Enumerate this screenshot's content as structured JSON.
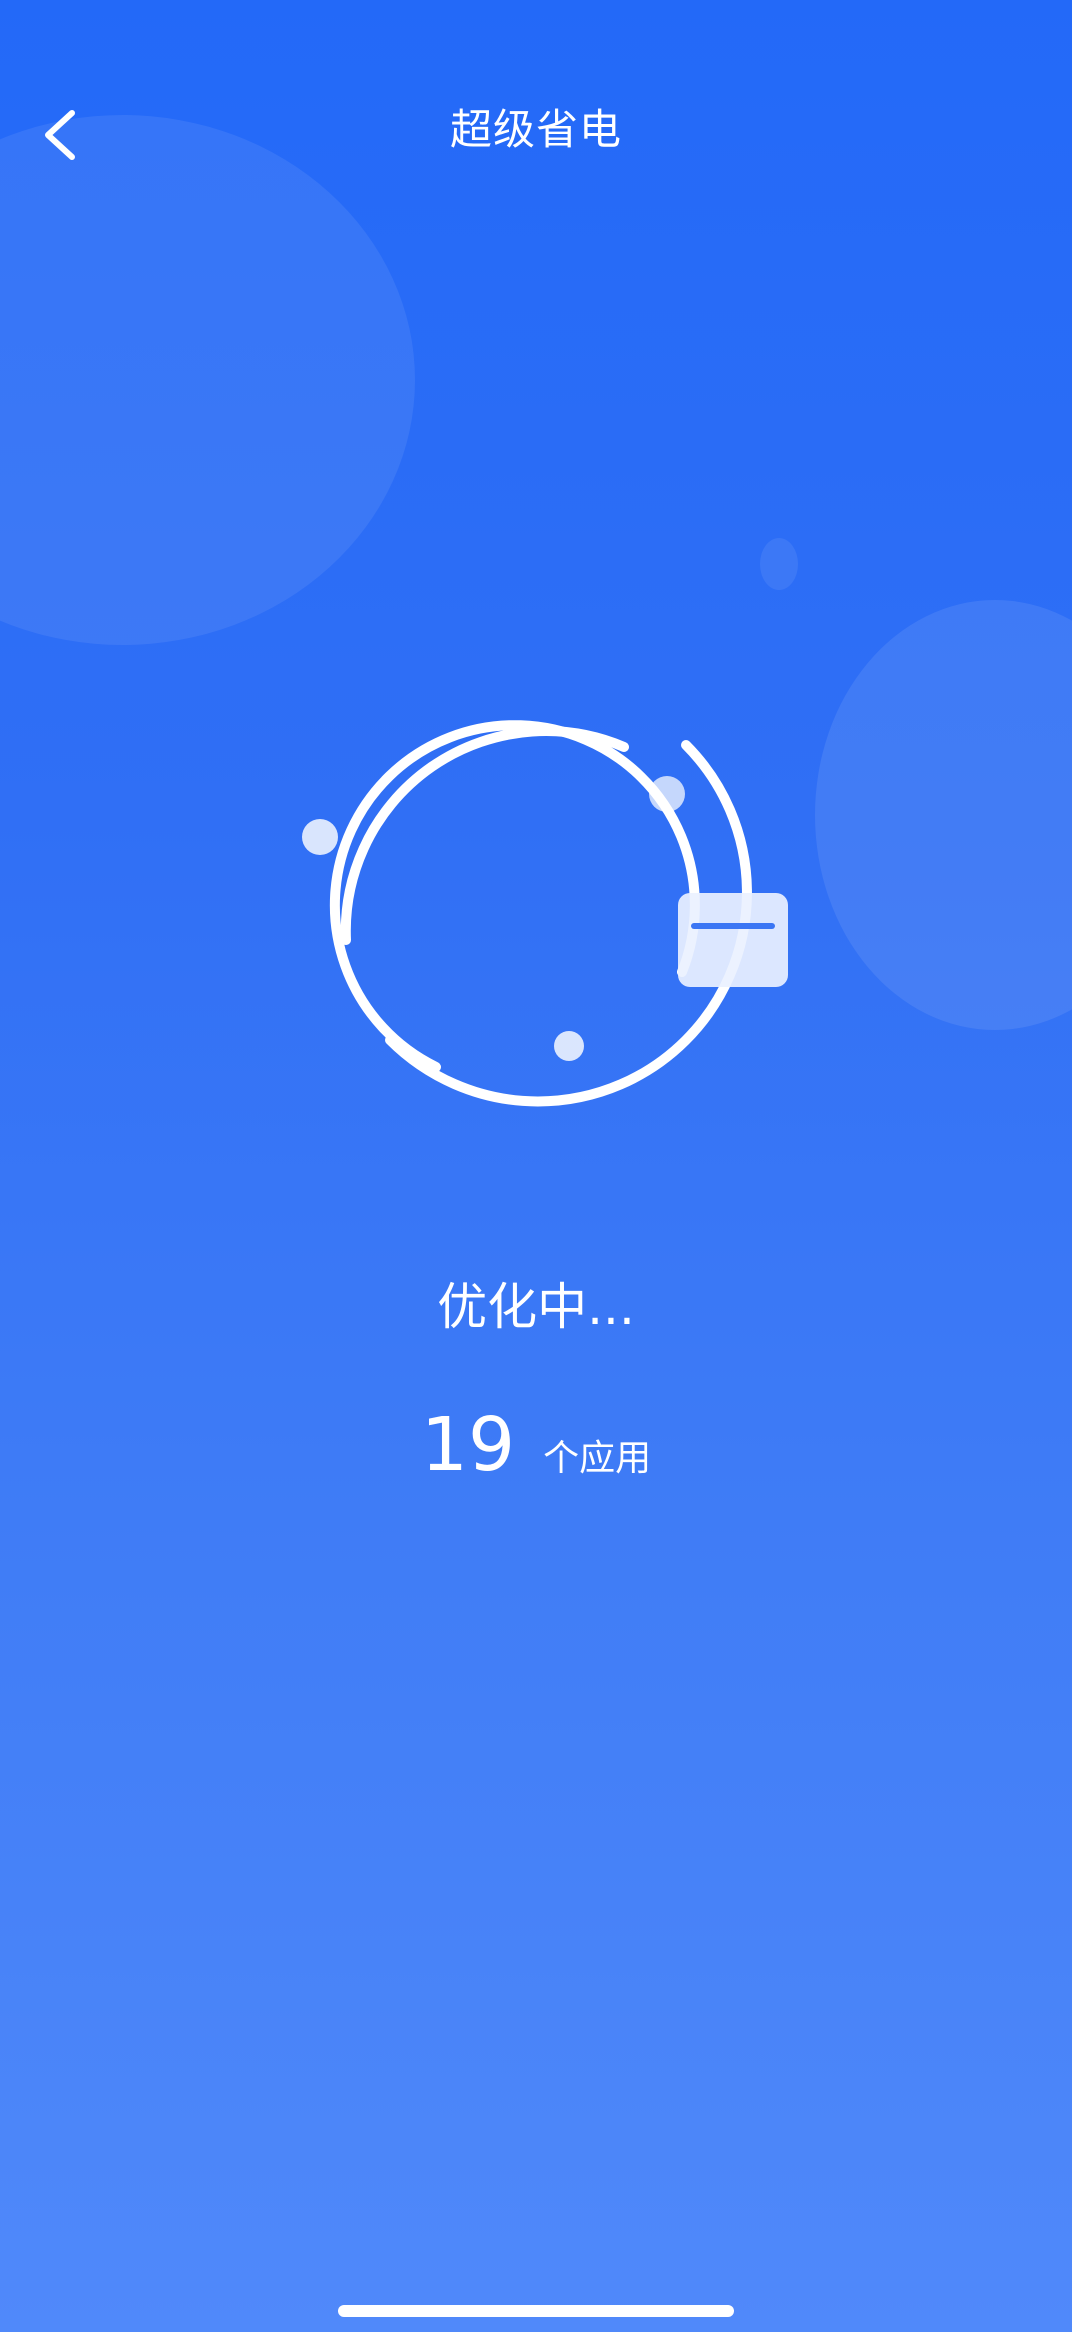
{
  "header": {
    "title": "超级省电"
  },
  "scan": {
    "status_text": "优化中...",
    "app_count": "19",
    "app_count_unit": "个应用"
  },
  "icons": {
    "back": "chevron-left-icon",
    "scan_ring": "scan-ring-icon",
    "app_tile": "app-tile-icon"
  },
  "colors": {
    "background_top": "#2369f8",
    "background_bottom": "#5089fa",
    "foreground": "#ffffff"
  }
}
